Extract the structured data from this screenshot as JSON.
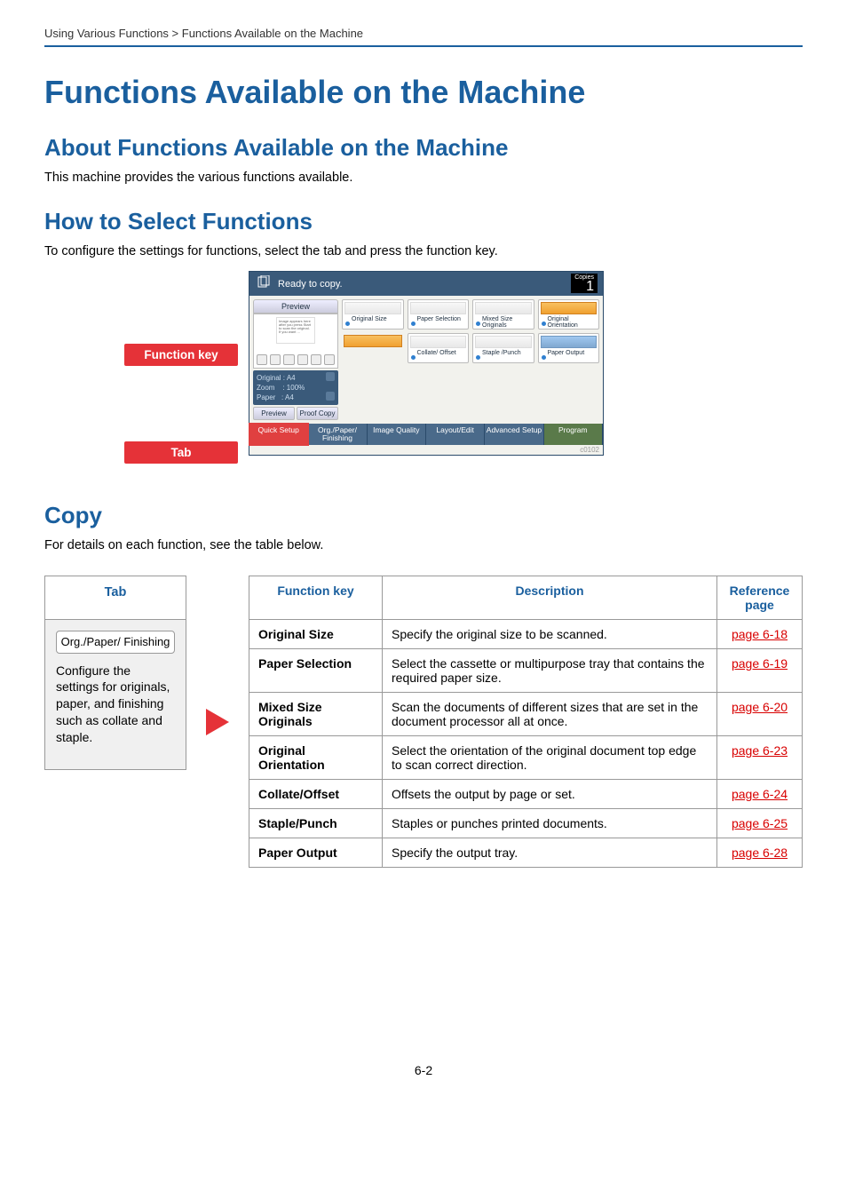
{
  "breadcrumb": "Using Various Functions > Functions Available on the Machine",
  "h1": "Functions Available on the Machine",
  "h2_about": "About Functions Available on the Machine",
  "p_about": "This machine provides the various functions available.",
  "h2_how": "How to Select Functions",
  "p_how": "To configure the settings for functions, select the tab and press the function key.",
  "labels": {
    "function_key": "Function key",
    "tab": "Tab"
  },
  "screenshot": {
    "title": "Ready to copy.",
    "copies_label": "Copies",
    "copies_value": "1",
    "preview": "Preview",
    "info": {
      "original": "Original",
      "original_v": "A4",
      "zoom": "Zoom",
      "zoom_v": "100%",
      "paper": "Paper",
      "paper_v": "A4"
    },
    "btn_preview": "Preview",
    "btn_proof": "Proof Copy",
    "fkeys": [
      "Original Size",
      "Paper Selection",
      "Mixed Size Originals",
      "Original Orientation",
      "",
      "Collate/ Offset",
      "Staple /Punch",
      "Paper Output"
    ],
    "tabs": [
      "Quick Setup",
      "Org./Paper/ Finishing",
      "Image Quality",
      "Layout/Edit",
      "Advanced Setup",
      "Program"
    ],
    "code": "c0102"
  },
  "h2_copy": "Copy",
  "p_copy": "For details on each function, see the table below.",
  "tab_panel": {
    "head": "Tab",
    "chip": "Org./Paper/\nFinishing",
    "desc": "Configure the settings for originals, paper, and finishing such as collate and staple."
  },
  "table": {
    "head": {
      "fn": "Function key",
      "desc": "Description",
      "ref": "Reference page"
    },
    "rows": [
      {
        "fn": "Original Size",
        "desc": "Specify the original size to be scanned.",
        "ref": "page 6-18"
      },
      {
        "fn": "Paper Selection",
        "desc": "Select the cassette or multipurpose tray that contains the required paper size.",
        "ref": "page 6-19"
      },
      {
        "fn": "Mixed Size Originals",
        "desc": "Scan the documents of different sizes that are set in the document processor all at once.",
        "ref": "page 6-20"
      },
      {
        "fn": "Original Orientation",
        "desc": "Select the orientation of the original document top edge to scan correct direction.",
        "ref": "page 6-23"
      },
      {
        "fn": "Collate/Offset",
        "desc": "Offsets the output by page or set.",
        "ref": "page 6-24"
      },
      {
        "fn": "Staple/Punch",
        "desc": "Staples or punches printed documents.",
        "ref": "page 6-25"
      },
      {
        "fn": "Paper Output",
        "desc": "Specify the output tray.",
        "ref": "page 6-28"
      }
    ]
  },
  "page_num": "6-2"
}
